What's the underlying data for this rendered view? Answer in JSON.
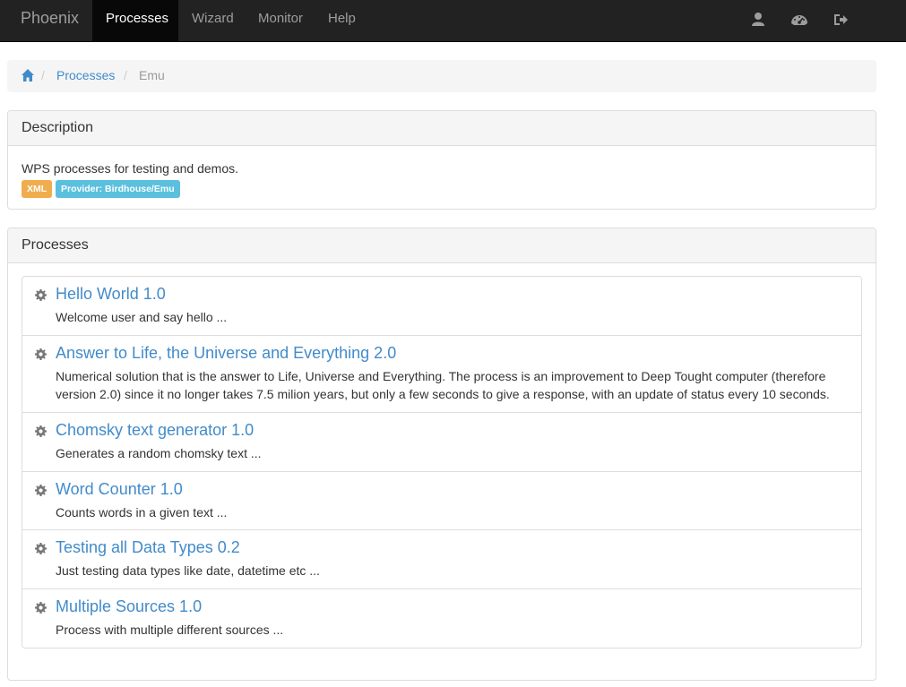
{
  "navbar": {
    "brand": "Phoenix",
    "items": [
      {
        "label": "Processes",
        "active": true
      },
      {
        "label": "Wizard",
        "active": false
      },
      {
        "label": "Monitor",
        "active": false
      },
      {
        "label": "Help",
        "active": false
      }
    ],
    "icons": [
      "user-icon",
      "dashboard-icon",
      "logout-icon"
    ]
  },
  "breadcrumb": {
    "home_icon": "home-icon",
    "items": [
      "Processes",
      "Emu"
    ]
  },
  "description": {
    "heading": "Description",
    "text": "WPS processes for testing and demos.",
    "labels": [
      "XML",
      "Provider: Birdhouse/Emu"
    ]
  },
  "processes": {
    "heading": "Processes",
    "items": [
      {
        "title": "Hello World 1.0",
        "text": "Welcome user and say hello ..."
      },
      {
        "title": "Answer to Life, the Universe and Everything 2.0",
        "text": "Numerical solution that is the answer to Life, Universe and Everything. The process is an improvement to Deep Tought computer (therefore version 2.0) since it no longer takes 7.5 milion years, but only a few seconds to give a response, with an update of status every 10 seconds."
      },
      {
        "title": "Chomsky text generator 1.0",
        "text": "Generates a random chomsky text ..."
      },
      {
        "title": "Word Counter 1.0",
        "text": "Counts words in a given text ..."
      },
      {
        "title": "Testing all Data Types 0.2",
        "text": "Just testing data types like date, datetime etc ..."
      },
      {
        "title": "Multiple Sources 1.0",
        "text": "Process with multiple different sources ..."
      }
    ]
  },
  "colors": {
    "navbar_bg": "#222222",
    "link": "#428bca",
    "warning": "#f0ad4e",
    "info": "#5bc0de"
  }
}
